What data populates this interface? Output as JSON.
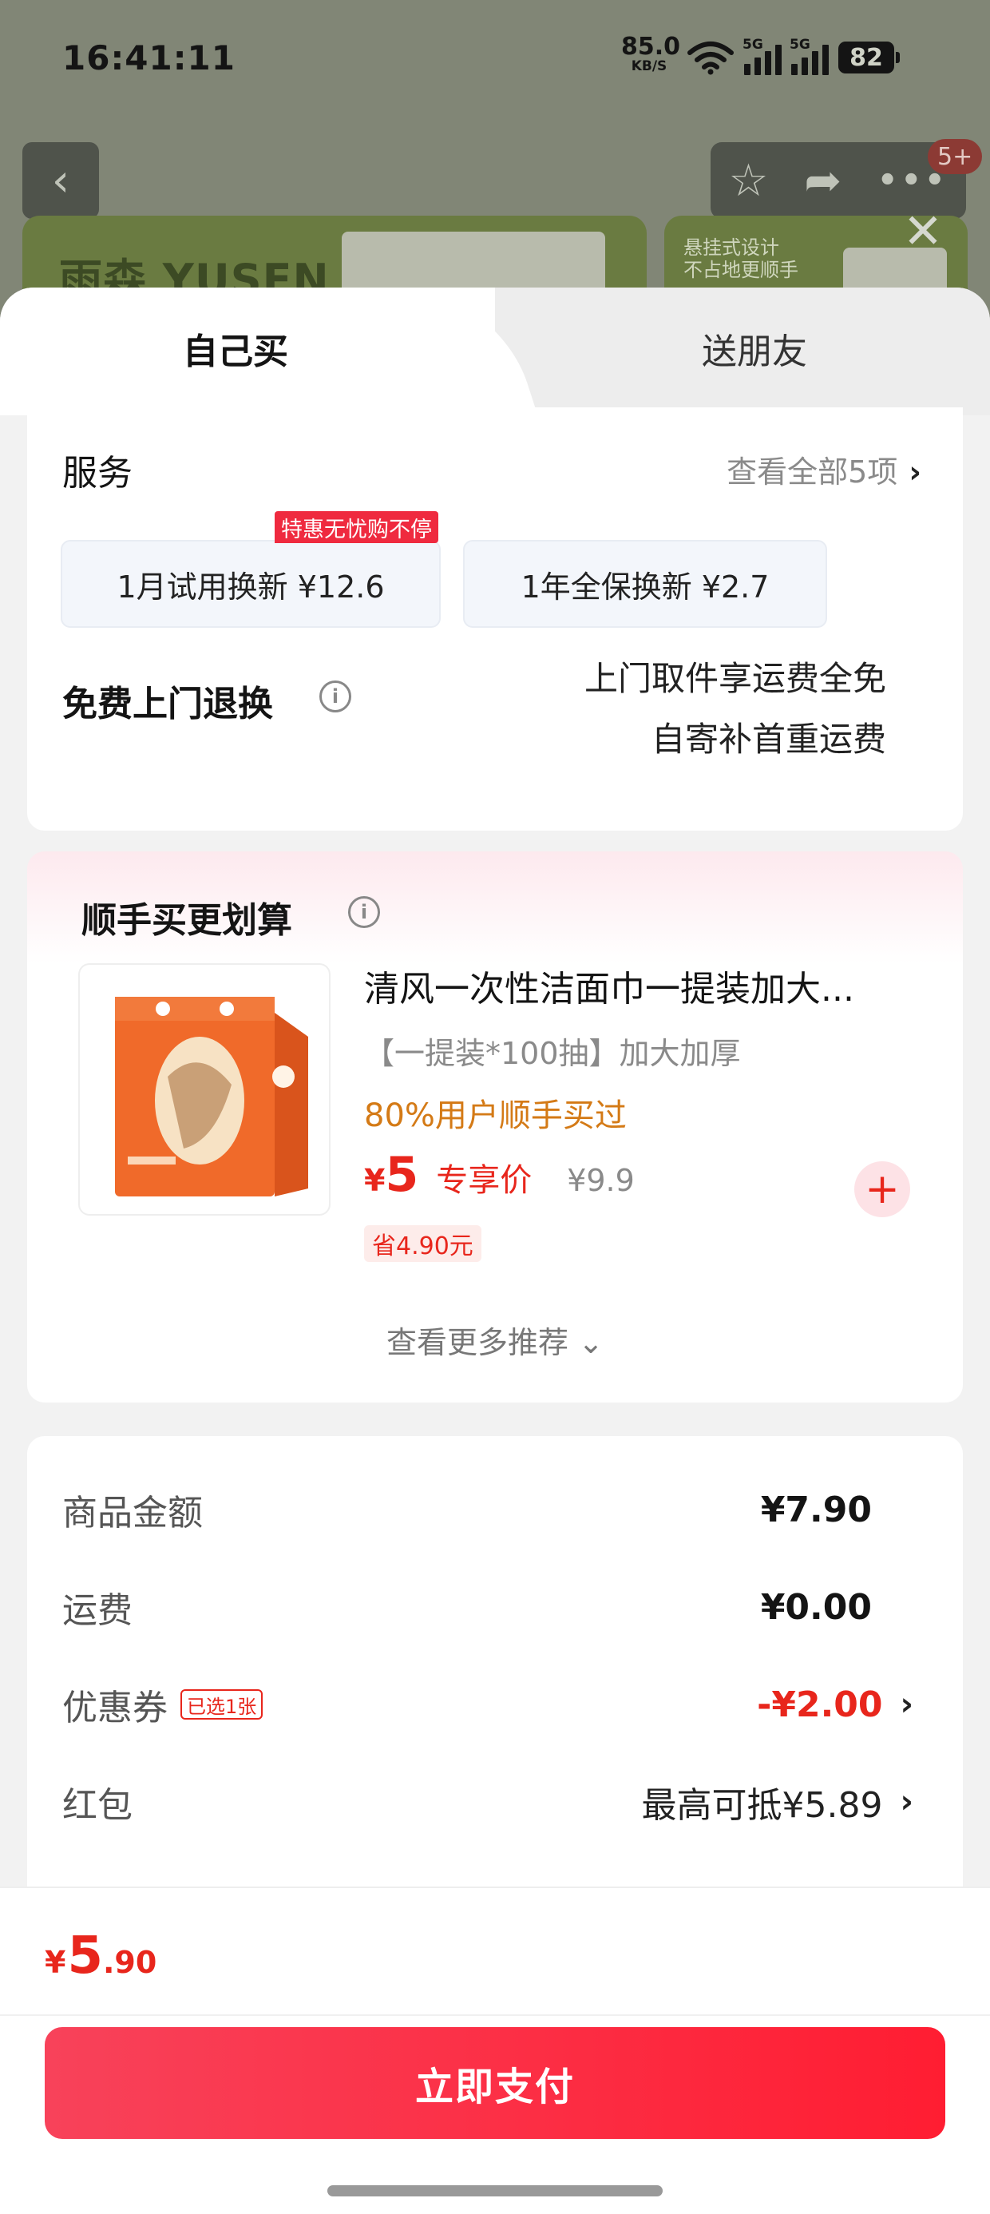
{
  "status_bar": {
    "time": "16:41:11",
    "net_speed": "85.0",
    "net_unit": "KB/S",
    "sig1_tag": "5G",
    "sig2_tag": "5G",
    "battery": "82"
  },
  "background_page": {
    "back_icon": "chevron-left",
    "cart_badge": "5+",
    "banner_brand": "雨森 YUSEN",
    "banner2_line1": "悬挂式设计",
    "banner2_line2": "不占地更顺手"
  },
  "tabs": [
    {
      "label": "自己买",
      "active": true
    },
    {
      "label": "送朋友",
      "active": false
    }
  ],
  "service": {
    "title": "服务",
    "see_all": "查看全部5项",
    "chips": [
      {
        "label": "1月试用换新  ¥12.6",
        "tag": "特惠无忧购不停"
      },
      {
        "label": "1年全保换新  ¥2.7"
      }
    ],
    "free_return_title": "免费上门退换",
    "free_return_line1": "上门取件享运费全免",
    "free_return_line2": "自寄补首重运费"
  },
  "recommend": {
    "title": "顺手买更划算",
    "product": {
      "name": "清风一次性洁面巾一提装加大...",
      "spec": "【一提装*100抽】加大加厚",
      "social": "80%用户顺手买过",
      "currency": "¥",
      "price": "5",
      "price_label": "专享价",
      "original_price": "¥9.9",
      "save_tag": "省4.90元"
    },
    "more": "查看更多推荐"
  },
  "summary": {
    "rows": [
      {
        "label": "商品金额",
        "value": "¥7.90"
      },
      {
        "label": "运费",
        "value": "¥0.00"
      },
      {
        "label": "优惠券",
        "tag": "已选1张",
        "value": "-¥2.00"
      },
      {
        "label": "红包",
        "value": "最高可抵¥5.89"
      }
    ]
  },
  "bottom": {
    "currency": "¥",
    "total_int": "5",
    "total_dec": ".90",
    "pay_label": "立即支付"
  },
  "colors": {
    "accent_red": "#e8261c",
    "pay_button": "#ff1d32",
    "orange_text": "#d47a16"
  }
}
